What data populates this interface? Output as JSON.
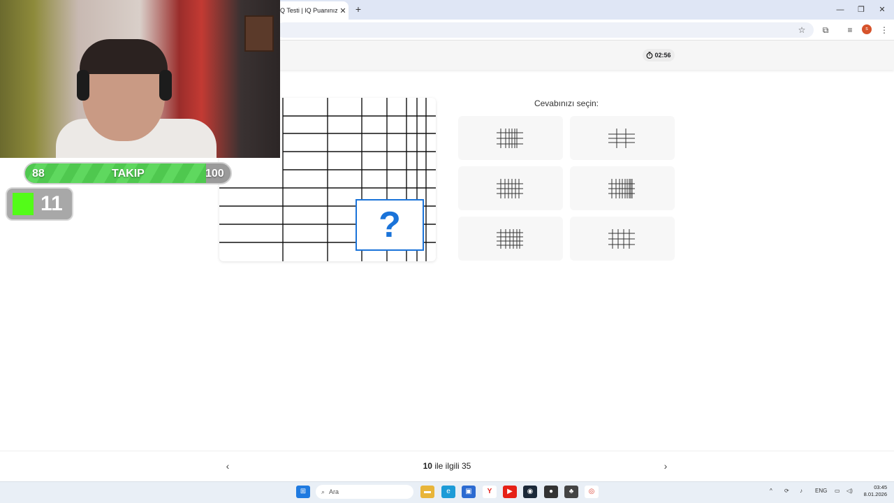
{
  "browser": {
    "tab_title": "Q Testi | IQ Puanınız",
    "tab_close": "✕",
    "new_tab": "+",
    "avatar_letter": "s"
  },
  "header": {
    "timer": "02:56"
  },
  "puzzle": {
    "missing_mark": "?"
  },
  "answers": {
    "title": "Cevabınızı seçin:"
  },
  "pagination": {
    "current": "10",
    "text": "ile ilgili 35"
  },
  "taskbar": {
    "search_placeholder": "Ara",
    "language": "ENG",
    "time": "03:45",
    "date": "8.01.2026"
  },
  "overlay": {
    "follow_current": "88",
    "follow_label": "TAKIP",
    "follow_goal": "100",
    "follow_progress": 0.88,
    "kick_count": "11"
  },
  "colors": {
    "accent_blue": "#1a73d9",
    "kick_green": "#53fc18",
    "follow_green": "#4fc84f"
  }
}
